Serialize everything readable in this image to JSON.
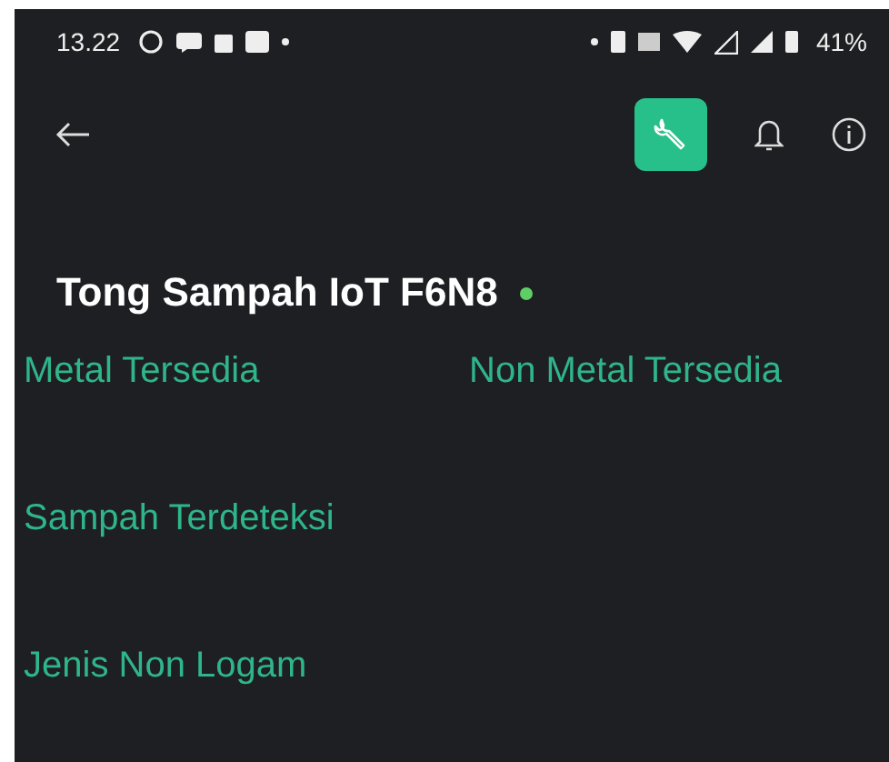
{
  "status_bar": {
    "time": "13.22",
    "battery": "41%"
  },
  "toolbar": {
    "settings_selected": true
  },
  "device": {
    "name": "Tong Sampah IoT F6N8",
    "online": true
  },
  "widgets": [
    {
      "label": "Metal Tersedia"
    },
    {
      "label": "Non Metal Tersedia"
    },
    {
      "label": "Sampah Terdeteksi"
    },
    {
      "label": "Jenis Non Logam"
    }
  ]
}
